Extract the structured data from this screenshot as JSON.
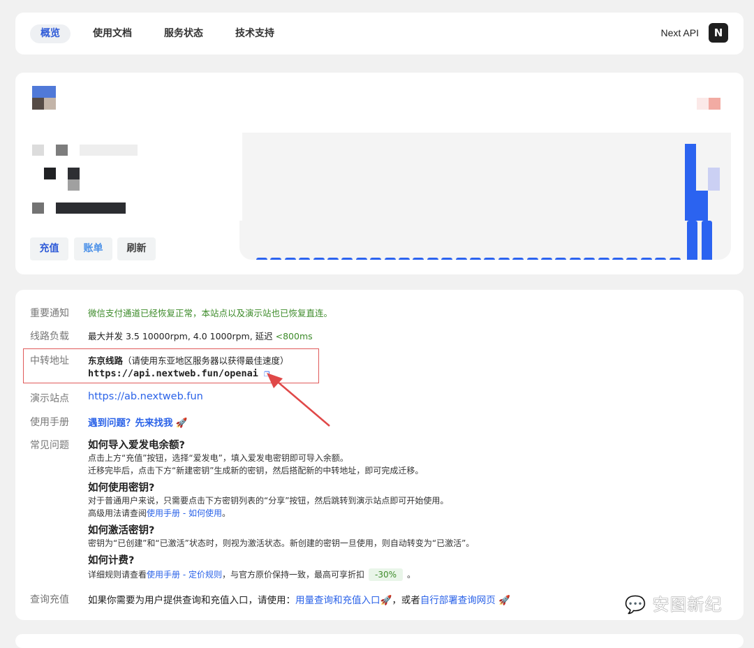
{
  "nav": {
    "items": [
      {
        "label": "概览",
        "active": true
      },
      {
        "label": "使用文档"
      },
      {
        "label": "服务状态"
      },
      {
        "label": "技术支持"
      }
    ],
    "brand": "Next API",
    "logo_text": "N"
  },
  "overview": {
    "buttons": {
      "recharge": "充值",
      "bill": "账单",
      "refresh": "刷新"
    },
    "usage_bars": [
      0.06,
      0.06,
      0.06,
      0.06,
      0.06,
      0.06,
      0.06,
      0.06,
      0.06,
      0.06,
      0.06,
      0.06,
      0.06,
      0.06,
      0.06,
      0.06,
      0.06,
      0.06,
      0.06,
      0.06,
      0.06,
      0.06,
      0.06,
      0.06,
      0.06,
      0.06,
      0.06,
      0.06,
      0.06,
      0.06,
      1,
      1
    ],
    "accent": "#2b63f0"
  },
  "info": {
    "notice": {
      "label": "重要通知",
      "text": "微信支付通道已经恢复正常，本站点以及演示站也已恢复直连。"
    },
    "load": {
      "label": "线路负载",
      "text": "最大并发 3.5 10000rpm, 4.0 1000rpm, 延迟 ",
      "latency": "<800ms"
    },
    "relay": {
      "label": "中转地址",
      "route": "东京线路",
      "route_note": "（请使用东亚地区服务器以获得最佳速度）",
      "url": "https://api.nextweb.fun/openai"
    },
    "demo": {
      "label": "演示站点",
      "url": "https://ab.nextweb.fun"
    },
    "manual": {
      "label": "使用手册",
      "link": "遇到问题？先来找我",
      "emoji": "🚀"
    },
    "faq": {
      "label": "常见问题",
      "items": [
        {
          "q": "如何导入爱发电余额?",
          "a1": "点击上方“充值”按钮，选择“爱发电”，填入爱发电密钥即可导入余额。",
          "a2": "迁移完毕后，点击下方“新建密钥”生成新的密钥，然后搭配新的中转地址，即可完成迁移。"
        },
        {
          "q": "如何使用密钥?",
          "a1": "对于普通用户来说，只需要点击下方密钥列表的“分享”按钮，然后跳转到演示站点即可开始使用。",
          "a2_pre": "高级用法请查阅",
          "a2_link": "使用手册 - 如何使用",
          "a2_post": "。"
        },
        {
          "q": "如何激活密钥?",
          "a1": "密钥为“已创建”和“已激活”状态时，则视为激活状态。新创建的密钥一旦使用，则自动转变为“已激活”。"
        },
        {
          "q": "如何计费?",
          "a1_pre": "详细规则请查看",
          "a1_link": "使用手册 - 定价规则",
          "a1_mid": "，与官方原价保持一致，最高可享折扣",
          "tag": "-30%",
          "a1_post": "。"
        }
      ]
    },
    "query": {
      "label": "查询充值",
      "pre": "如果你需要为用户提供查询和充值入口，请使用：",
      "link1": "用量查询和充值入口",
      "mid": "，或者",
      "link2": "自行部署查询网页",
      "emoji": "🚀"
    }
  },
  "watermark": "安图新纪"
}
